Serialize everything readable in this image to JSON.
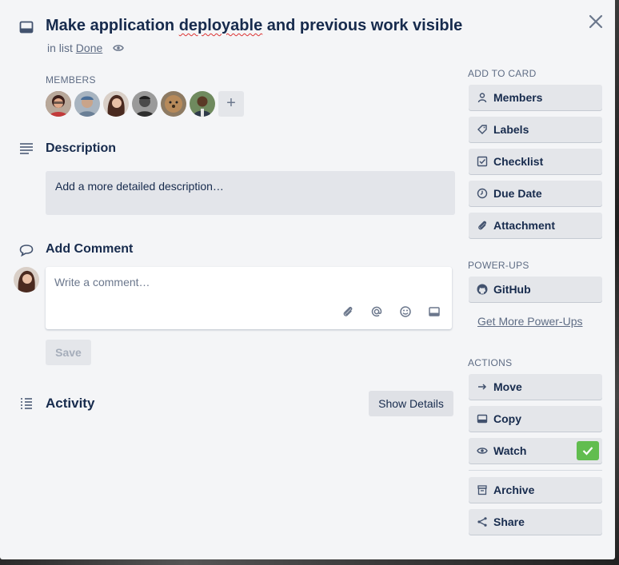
{
  "card": {
    "title_part1": "Make application ",
    "title_part2": "deployable",
    "title_part3": " and previous work visible",
    "in_list_prefix": "in list ",
    "list_name": "Done"
  },
  "members": {
    "label": "MEMBERS",
    "add_symbol": "+"
  },
  "description": {
    "heading": "Description",
    "placeholder": "Add a more detailed description…"
  },
  "comment": {
    "heading": "Add Comment",
    "placeholder": "Write a comment…",
    "save_label": "Save"
  },
  "activity": {
    "heading": "Activity",
    "show_details_label": "Show Details"
  },
  "sidebar": {
    "add_to_card_label": "ADD TO CARD",
    "add_to_card": [
      {
        "label": "Members",
        "icon": "person-icon"
      },
      {
        "label": "Labels",
        "icon": "tag-icon"
      },
      {
        "label": "Checklist",
        "icon": "checkbox-icon"
      },
      {
        "label": "Due Date",
        "icon": "clock-icon"
      },
      {
        "label": "Attachment",
        "icon": "paperclip-icon"
      }
    ],
    "power_ups_label": "POWER-UPS",
    "github_label": "GitHub",
    "get_more_label": "Get More Power-Ups",
    "actions_label": "ACTIONS",
    "actions": [
      {
        "label": "Move",
        "icon": "arrow-right-icon"
      },
      {
        "label": "Copy",
        "icon": "card-icon"
      },
      {
        "label": "Watch",
        "icon": "eye-icon",
        "checked": true
      },
      {
        "label": "Archive",
        "icon": "archive-icon"
      },
      {
        "label": "Share",
        "icon": "share-icon"
      }
    ]
  },
  "colors": {
    "modal_bg": "#f4f5f7",
    "button_bg": "#e4e6ea",
    "text_dark": "#172b4d",
    "text_muted": "#5e6c84",
    "watch_check": "#61bd4f"
  }
}
